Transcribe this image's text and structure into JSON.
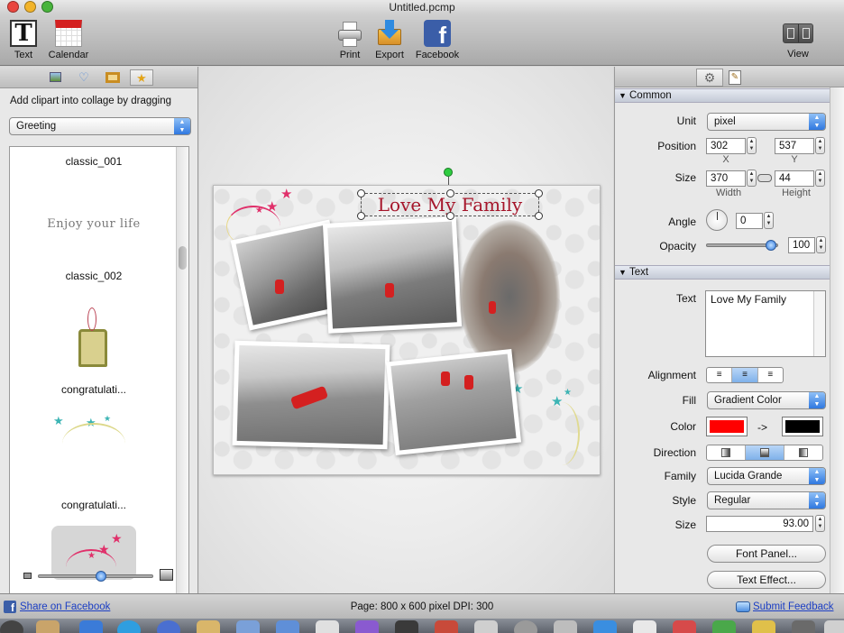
{
  "window": {
    "title": "Untitled.pcmp"
  },
  "toolbar": {
    "text_label": "Text",
    "calendar_label": "Calendar",
    "print_label": "Print",
    "export_label": "Export",
    "facebook_label": "Facebook",
    "view_label": "View"
  },
  "left_panel": {
    "hint": "Add clipart into collage by dragging",
    "category": "Greeting",
    "clips": [
      {
        "name": "classic_001"
      },
      {
        "preview_text": "Enjoy your life"
      },
      {
        "name": "classic_002"
      },
      {
        "name": "congratulati..."
      },
      {
        "name": "congratulati..."
      }
    ],
    "zoom_slider_value": 0.55
  },
  "canvas": {
    "title_text": "Love My Family"
  },
  "right_panel": {
    "common_section": "Common",
    "unit_label": "Unit",
    "unit_value": "pixel",
    "position_label": "Position",
    "pos_x": "302",
    "pos_y": "537",
    "x_label": "X",
    "y_label": "Y",
    "size_label": "Size",
    "width_value": "370",
    "height_value": "44",
    "width_label": "Width",
    "height_label": "Height",
    "angle_label": "Angle",
    "angle_value": "0",
    "opacity_label": "Opacity",
    "opacity_value": "100",
    "opacity_slider": 0.9,
    "text_section": "Text",
    "text_label": "Text",
    "text_value": "Love My Family",
    "alignment_label": "Alignment",
    "fill_label": "Fill",
    "fill_value": "Gradient Color",
    "color_label": "Color",
    "color_from": "#ff0000",
    "color_arrow": "->",
    "color_to": "#000000",
    "direction_label": "Direction",
    "family_label": "Family",
    "family_value": "Lucida Grande",
    "style_label": "Style",
    "style_value": "Regular",
    "size2_label": "Size",
    "size2_value": "93.00",
    "font_panel_button": "Font Panel...",
    "text_effect_button": "Text Effect..."
  },
  "status": {
    "share_link": "Share on Facebook",
    "page_info": "Page: 800 x 600 pixel DPI: 300",
    "feedback_link": "Submit Feedback"
  }
}
